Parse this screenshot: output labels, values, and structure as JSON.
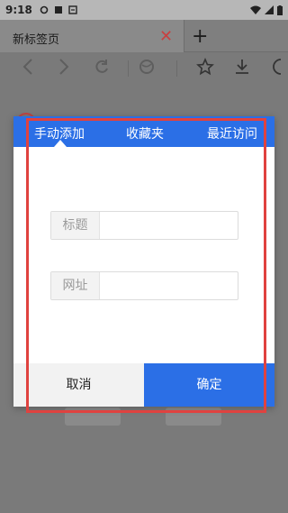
{
  "status_bar": {
    "time": "9:18"
  },
  "browser": {
    "tab_title": "新标签页",
    "new_tab_symbol": "+",
    "close_symbol": "✕"
  },
  "dialog": {
    "tabs": [
      {
        "label": "手动添加",
        "active": true
      },
      {
        "label": "收藏夹",
        "active": false
      },
      {
        "label": "最近访问",
        "active": false
      }
    ],
    "title_field": {
      "label": "标题",
      "value": ""
    },
    "url_field": {
      "label": "网址",
      "value": ""
    },
    "cancel_label": "取消",
    "confirm_label": "确定"
  },
  "colors": {
    "accent": "#2b6fe6",
    "highlight": "#e0423f"
  }
}
